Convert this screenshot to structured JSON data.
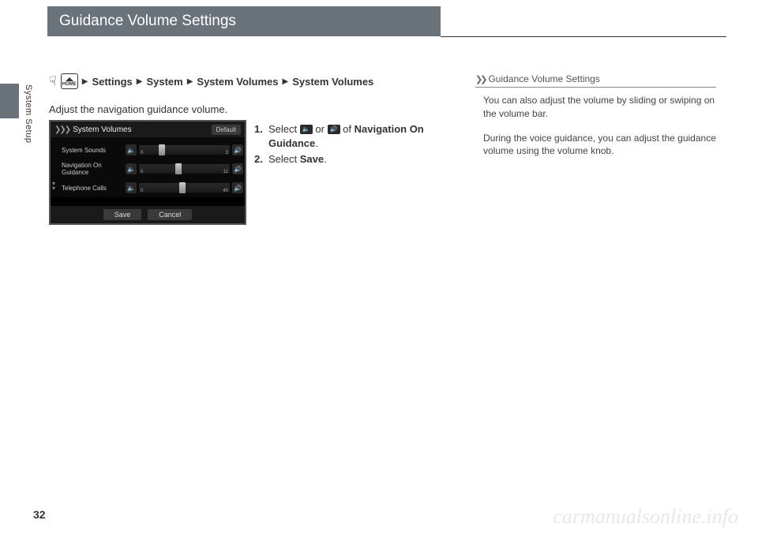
{
  "header": {
    "title": "Guidance Volume Settings"
  },
  "side": {
    "section": "System Setup"
  },
  "breadcrumb": {
    "home_label": "HOME",
    "parts": [
      "Settings",
      "System",
      "System Volumes",
      "System Volumes"
    ]
  },
  "intro": "Adjust the navigation guidance volume.",
  "screenshot": {
    "title": "System Volumes",
    "default_btn": "Default",
    "rows": [
      {
        "label": "System Sounds",
        "min": "0",
        "max": "3",
        "thumb_pct": 22
      },
      {
        "label": "Navigation On Guidance",
        "min": "0",
        "max": "11",
        "thumb_pct": 40
      },
      {
        "label": "Telephone Calls",
        "min": "0",
        "max": "40",
        "thumb_pct": 44
      }
    ],
    "vol_down_glyph": "🔈",
    "vol_up_glyph": "🔊",
    "save_btn": "Save",
    "cancel_btn": "Cancel"
  },
  "steps": {
    "s1_num": "1.",
    "s1_pre": "Select ",
    "s1_mid": " or ",
    "s1_post": " of ",
    "s1_target": "Navigation On Guidance",
    "s1_end": ".",
    "s2_num": "2.",
    "s2_pre": "Select ",
    "s2_target": "Save",
    "s2_end": "."
  },
  "note": {
    "title": "Guidance Volume Settings",
    "p1": "You can also adjust the volume by sliding or swiping on the volume bar.",
    "p2": "During the voice guidance, you can adjust the guidance volume using the volume knob."
  },
  "page_number": "32",
  "watermark": "carmanualsonline.info"
}
